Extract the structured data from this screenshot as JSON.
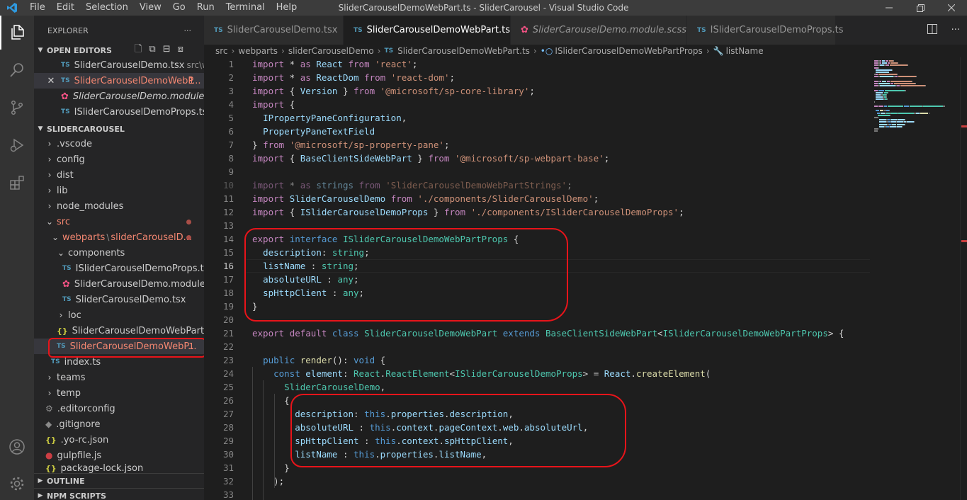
{
  "window": {
    "title": "SliderCarouselDemoWebPart.ts - SliderCarousel - Visual Studio Code",
    "menu": [
      "File",
      "Edit",
      "Selection",
      "View",
      "Go",
      "Run",
      "Terminal",
      "Help"
    ]
  },
  "activity_bar": {
    "items": [
      "explorer-icon",
      "search-icon",
      "source-control-icon",
      "run-debug-icon",
      "extensions-icon"
    ],
    "bottom": [
      "account-icon",
      "manage-gear-icon"
    ]
  },
  "sidebar": {
    "title": "EXPLORER",
    "more": "···",
    "open_editors_label": "OPEN EDITORS",
    "open_editors": [
      {
        "name": "SliderCarouselDemo.tsx",
        "path": "src\\we...",
        "type": "ts",
        "badge": "",
        "selected": false
      },
      {
        "name": "SliderCarouselDemoWebP...",
        "path": "",
        "type": "ts",
        "badge": "1",
        "selected": true
      },
      {
        "name": "SliderCarouselDemo.module.sc...",
        "path": "",
        "type": "scss",
        "badge": "",
        "selected": false
      },
      {
        "name": "ISliderCarouselDemoProps.ts...",
        "path": "",
        "type": "ts",
        "badge": "",
        "selected": false
      }
    ],
    "workspace_label": "SLIDERCAROUSEL",
    "tree": {
      "vscode": ".vscode",
      "config": "config",
      "dist": "dist",
      "lib": "lib",
      "node_modules": "node_modules",
      "src": "src",
      "webparts": "webparts",
      "webparts_sep": "\\",
      "webparts_sub": "sliderCarouselD...",
      "components": "components",
      "props_file": "ISliderCarouselDemoProps.ts",
      "module_file": "SliderCarouselDemo.module.s...",
      "tsx_file": "SliderCarouselDemo.tsx",
      "loc": "loc",
      "manifest_file": "SliderCarouselDemoWebPart.m...",
      "webpart_file": "SliderCarouselDemoWebP...",
      "webpart_badge": "1",
      "index_file": "index.ts",
      "teams": "teams",
      "temp": "temp",
      "editorconfig": ".editorconfig",
      "gitignore": ".gitignore",
      "yorc": ".yo-rc.json",
      "gulpfile": "gulpfile.js",
      "packagelock": "package-lock.json"
    },
    "outline_label": "OUTLINE",
    "npm_label": "NPM SCRIPTS"
  },
  "tabs": [
    {
      "label": "SliderCarouselDemo.tsx",
      "active": false,
      "italic": false,
      "close": ""
    },
    {
      "label": "SliderCarouselDemoWebPart.ts",
      "active": true,
      "italic": false,
      "close": "×"
    },
    {
      "label": "SliderCarouselDemo.module.scss",
      "active": false,
      "italic": true,
      "close": ""
    },
    {
      "label": "ISliderCarouselDemoProps.ts",
      "active": false,
      "italic": false,
      "close": ""
    }
  ],
  "breadcrumb": [
    "src",
    "webparts",
    "sliderCarouselDemo",
    "SliderCarouselDemoWebPart.ts",
    "ISliderCarouselDemoWebPartProps",
    "listName"
  ],
  "editor": {
    "current_line": 16,
    "lines": [
      {
        "n": "1",
        "t": [
          [
            "kc",
            "import"
          ],
          [
            "pl",
            " * "
          ],
          [
            "kc",
            "as"
          ],
          [
            "pl",
            " "
          ],
          [
            "var",
            "React"
          ],
          [
            "pl",
            " "
          ],
          [
            "kc",
            "from"
          ],
          [
            "pl",
            " "
          ],
          [
            "str",
            "'react'"
          ],
          [
            "pl",
            ";"
          ]
        ]
      },
      {
        "n": "2",
        "t": [
          [
            "kc",
            "import"
          ],
          [
            "pl",
            " * "
          ],
          [
            "kc",
            "as"
          ],
          [
            "pl",
            " "
          ],
          [
            "var",
            "ReactDom"
          ],
          [
            "pl",
            " "
          ],
          [
            "kc",
            "from"
          ],
          [
            "pl",
            " "
          ],
          [
            "str",
            "'react-dom'"
          ],
          [
            "pl",
            ";"
          ]
        ]
      },
      {
        "n": "3",
        "t": [
          [
            "kc",
            "import"
          ],
          [
            "pl",
            " { "
          ],
          [
            "var",
            "Version"
          ],
          [
            "pl",
            " } "
          ],
          [
            "kc",
            "from"
          ],
          [
            "pl",
            " "
          ],
          [
            "str",
            "'@microsoft/sp-core-library'"
          ],
          [
            "pl",
            ";"
          ]
        ]
      },
      {
        "n": "4",
        "t": [
          [
            "kc",
            "import"
          ],
          [
            "pl",
            " {"
          ]
        ]
      },
      {
        "n": "5",
        "t": [
          [
            "pl",
            "  "
          ],
          [
            "var",
            "IPropertyPaneConfiguration"
          ],
          [
            "pl",
            ","
          ]
        ]
      },
      {
        "n": "6",
        "t": [
          [
            "pl",
            "  "
          ],
          [
            "var",
            "PropertyPaneTextField"
          ]
        ]
      },
      {
        "n": "7",
        "t": [
          [
            "pl",
            "} "
          ],
          [
            "kc",
            "from"
          ],
          [
            "pl",
            " "
          ],
          [
            "str",
            "'@microsoft/sp-property-pane'"
          ],
          [
            "pl",
            ";"
          ]
        ]
      },
      {
        "n": "8",
        "t": [
          [
            "kc",
            "import"
          ],
          [
            "pl",
            " { "
          ],
          [
            "var",
            "BaseClientSideWebPart"
          ],
          [
            "pl",
            " } "
          ],
          [
            "kc",
            "from"
          ],
          [
            "pl",
            " "
          ],
          [
            "str",
            "'@microsoft/sp-webpart-base'"
          ],
          [
            "pl",
            ";"
          ]
        ]
      },
      {
        "n": "9",
        "t": []
      },
      {
        "n": "10",
        "dim": true,
        "t": [
          [
            "kc",
            "import"
          ],
          [
            "pl",
            " * "
          ],
          [
            "kc",
            "as"
          ],
          [
            "pl",
            " "
          ],
          [
            "var",
            "strings"
          ],
          [
            "pl",
            " "
          ],
          [
            "kc",
            "from"
          ],
          [
            "pl",
            " "
          ],
          [
            "str",
            "'SliderCarouselDemoWebPartStrings'"
          ],
          [
            "pl",
            ";"
          ]
        ]
      },
      {
        "n": "11",
        "t": [
          [
            "kc",
            "import"
          ],
          [
            "pl",
            " "
          ],
          [
            "var",
            "SliderCarouselDemo"
          ],
          [
            "pl",
            " "
          ],
          [
            "kc",
            "from"
          ],
          [
            "pl",
            " "
          ],
          [
            "str",
            "'./components/SliderCarouselDemo'"
          ],
          [
            "pl",
            ";"
          ]
        ]
      },
      {
        "n": "12",
        "t": [
          [
            "kc",
            "import"
          ],
          [
            "pl",
            " { "
          ],
          [
            "var",
            "ISliderCarouselDemoProps"
          ],
          [
            "pl",
            " } "
          ],
          [
            "kc",
            "from"
          ],
          [
            "pl",
            " "
          ],
          [
            "str",
            "'./components/ISliderCarouselDemoProps'"
          ],
          [
            "pl",
            ";"
          ]
        ]
      },
      {
        "n": "13",
        "t": []
      },
      {
        "n": "14",
        "t": [
          [
            "kc",
            "export"
          ],
          [
            "pl",
            " "
          ],
          [
            "kw",
            "interface"
          ],
          [
            "pl",
            " "
          ],
          [
            "typ",
            "ISliderCarouselDemoWebPartProps"
          ],
          [
            "pl",
            " {"
          ]
        ]
      },
      {
        "n": "15",
        "t": [
          [
            "pl",
            "  "
          ],
          [
            "var",
            "description"
          ],
          [
            "pl",
            ": "
          ],
          [
            "typ",
            "string"
          ],
          [
            "pl",
            ";"
          ]
        ]
      },
      {
        "n": "16",
        "t": [
          [
            "pl",
            "  "
          ],
          [
            "var",
            "listName"
          ],
          [
            "pl",
            " : "
          ],
          [
            "typ",
            "string"
          ],
          [
            "pl",
            ";"
          ]
        ]
      },
      {
        "n": "17",
        "t": [
          [
            "pl",
            "  "
          ],
          [
            "var",
            "absoluteURL"
          ],
          [
            "pl",
            " : "
          ],
          [
            "typ",
            "any"
          ],
          [
            "pl",
            ";"
          ]
        ]
      },
      {
        "n": "18",
        "t": [
          [
            "pl",
            "  "
          ],
          [
            "var",
            "spHttpClient"
          ],
          [
            "pl",
            " : "
          ],
          [
            "typ",
            "any"
          ],
          [
            "pl",
            ";"
          ]
        ]
      },
      {
        "n": "19",
        "t": [
          [
            "pl",
            "}"
          ]
        ]
      },
      {
        "n": "20",
        "t": []
      },
      {
        "n": "21",
        "t": [
          [
            "kc",
            "export"
          ],
          [
            "pl",
            " "
          ],
          [
            "kc",
            "default"
          ],
          [
            "pl",
            " "
          ],
          [
            "kw",
            "class"
          ],
          [
            "pl",
            " "
          ],
          [
            "typ",
            "SliderCarouselDemoWebPart"
          ],
          [
            "pl",
            " "
          ],
          [
            "kw",
            "extends"
          ],
          [
            "pl",
            " "
          ],
          [
            "typ",
            "BaseClientSideWebPart"
          ],
          [
            "pl",
            "<"
          ],
          [
            "typ",
            "ISliderCarouselDemoWebPartProps"
          ],
          [
            "pl",
            "> {"
          ]
        ]
      },
      {
        "n": "22",
        "t": []
      },
      {
        "n": "23",
        "t": [
          [
            "pl",
            "  "
          ],
          [
            "kw",
            "public"
          ],
          [
            "pl",
            " "
          ],
          [
            "fn",
            "render"
          ],
          [
            "pl",
            "(): "
          ],
          [
            "kw",
            "void"
          ],
          [
            "pl",
            " {"
          ]
        ]
      },
      {
        "n": "24",
        "t": [
          [
            "pl",
            "    "
          ],
          [
            "kw",
            "const"
          ],
          [
            "pl",
            " "
          ],
          [
            "var",
            "element"
          ],
          [
            "pl",
            ": "
          ],
          [
            "typ",
            "React"
          ],
          [
            "pl",
            "."
          ],
          [
            "typ",
            "ReactElement"
          ],
          [
            "pl",
            "<"
          ],
          [
            "typ",
            "ISliderCarouselDemoProps"
          ],
          [
            "pl",
            "> = "
          ],
          [
            "var",
            "React"
          ],
          [
            "pl",
            "."
          ],
          [
            "fn",
            "createElement"
          ],
          [
            "pl",
            "("
          ]
        ]
      },
      {
        "n": "25",
        "t": [
          [
            "pl",
            "      "
          ],
          [
            "typ",
            "SliderCarouselDemo"
          ],
          [
            "pl",
            ","
          ]
        ]
      },
      {
        "n": "26",
        "t": [
          [
            "pl",
            "      {"
          ]
        ]
      },
      {
        "n": "27",
        "t": [
          [
            "pl",
            "        "
          ],
          [
            "var",
            "description"
          ],
          [
            "pl",
            ": "
          ],
          [
            "kw",
            "this"
          ],
          [
            "pl",
            "."
          ],
          [
            "var",
            "properties"
          ],
          [
            "pl",
            "."
          ],
          [
            "var",
            "description"
          ],
          [
            "pl",
            ","
          ]
        ]
      },
      {
        "n": "28",
        "t": [
          [
            "pl",
            "        "
          ],
          [
            "var",
            "absoluteURL"
          ],
          [
            "pl",
            " : "
          ],
          [
            "kw",
            "this"
          ],
          [
            "pl",
            "."
          ],
          [
            "var",
            "context"
          ],
          [
            "pl",
            "."
          ],
          [
            "var",
            "pageContext"
          ],
          [
            "pl",
            "."
          ],
          [
            "var",
            "web"
          ],
          [
            "pl",
            "."
          ],
          [
            "var",
            "absoluteUrl"
          ],
          [
            "pl",
            ","
          ]
        ]
      },
      {
        "n": "29",
        "t": [
          [
            "pl",
            "        "
          ],
          [
            "var",
            "spHttpClient"
          ],
          [
            "pl",
            " : "
          ],
          [
            "kw",
            "this"
          ],
          [
            "pl",
            "."
          ],
          [
            "var",
            "context"
          ],
          [
            "pl",
            "."
          ],
          [
            "var",
            "spHttpClient"
          ],
          [
            "pl",
            ","
          ]
        ]
      },
      {
        "n": "30",
        "t": [
          [
            "pl",
            "        "
          ],
          [
            "var",
            "listName"
          ],
          [
            "pl",
            " : "
          ],
          [
            "kw",
            "this"
          ],
          [
            "pl",
            "."
          ],
          [
            "var",
            "properties"
          ],
          [
            "pl",
            "."
          ],
          [
            "var",
            "listName"
          ],
          [
            "pl",
            ","
          ]
        ]
      },
      {
        "n": "31",
        "t": [
          [
            "pl",
            "      }"
          ]
        ]
      },
      {
        "n": "32",
        "t": [
          [
            "pl",
            "    );"
          ]
        ]
      },
      {
        "n": "33",
        "t": []
      }
    ]
  },
  "colors": {
    "accent": "#007acc",
    "annotation": "#e8141a",
    "keyword": "#569cd6",
    "control_keyword": "#c586c0",
    "string": "#ce9178",
    "type": "#4ec9b0",
    "variable": "#9cdcfe",
    "function": "#dcdcaa"
  }
}
